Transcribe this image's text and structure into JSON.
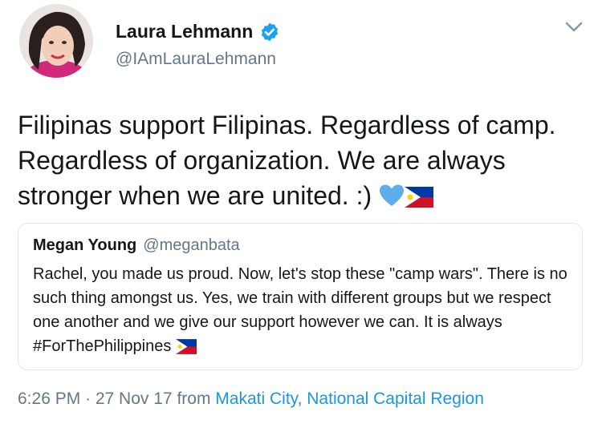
{
  "author": {
    "display_name": "Laura Lehmann",
    "handle": "@IAmLauraLehmann",
    "verified": true
  },
  "tweet": {
    "text": "Filipinas support Filipinas. Regardless of camp. Regardless of organization. We are always stronger when we are united. :) ",
    "emojis": [
      "blue-heart",
      "philippines-flag"
    ]
  },
  "quoted_tweet": {
    "display_name": "Megan Young",
    "handle": "@meganbata",
    "text": "Rachel, you made us proud. Now, let's stop these \"camp wars\". There is no such thing amongst us. Yes, we train with different groups but we respect one another and we give our support however we can. It is always #ForThePhilippines ",
    "emojis": [
      "philippines-flag"
    ]
  },
  "meta": {
    "timestamp": "6:26 PM · 27 Nov 17",
    "from_prefix": "from",
    "location": "Makati City, National Capital Region"
  },
  "colors": {
    "text": "#14171a",
    "secondary": "#657786",
    "link": "#1b95e0",
    "verified": "#1da1f2",
    "border": "#e1e8ed"
  },
  "icons": [
    "verified-badge-icon",
    "chevron-down-icon"
  ]
}
